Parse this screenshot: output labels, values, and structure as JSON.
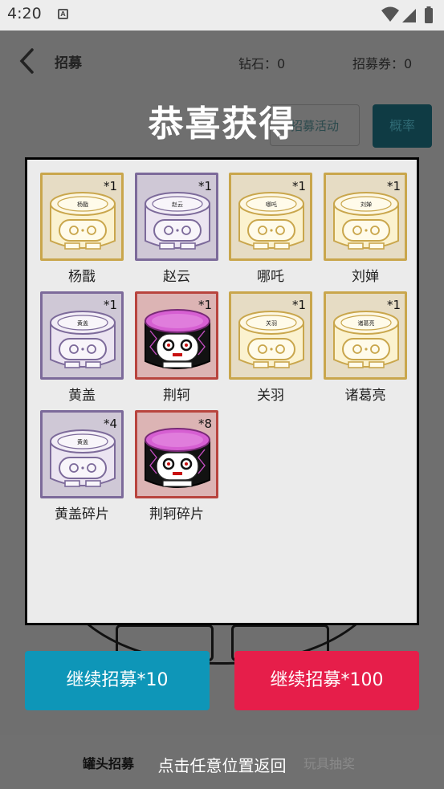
{
  "status_bar": {
    "time": "4:20",
    "notif_letter": "A"
  },
  "app_bar": {
    "title": "招募",
    "diamond": "钻石：0",
    "ticket": "招募券：0"
  },
  "background_buttons": {
    "activity": "招募活动",
    "probability": "概率"
  },
  "overlay": {
    "headline": "恭喜获得"
  },
  "items": [
    {
      "name": "杨戬",
      "count": "*1",
      "can_label": "杨戬",
      "style": "gold"
    },
    {
      "name": "赵云",
      "count": "*1",
      "can_label": "赵云",
      "style": "purple"
    },
    {
      "name": "哪吒",
      "count": "*1",
      "can_label": "哪吒",
      "style": "gold"
    },
    {
      "name": "刘婵",
      "count": "*1",
      "can_label": "刘婵",
      "style": "gold"
    },
    {
      "name": "黄盖",
      "count": "*1",
      "can_label": "黄盖",
      "style": "purple"
    },
    {
      "name": "荆轲",
      "count": "*1",
      "can_label": "",
      "style": "red"
    },
    {
      "name": "关羽",
      "count": "*1",
      "can_label": "关羽",
      "style": "gold"
    },
    {
      "name": "诸葛亮",
      "count": "*1",
      "can_label": "诸葛亮",
      "style": "gold"
    },
    {
      "name": "黄盖碎片",
      "count": "*4",
      "can_label": "黄盖",
      "style": "purple"
    },
    {
      "name": "荆轲碎片",
      "count": "*8",
      "can_label": "",
      "style": "red"
    }
  ],
  "actions": {
    "continue_10": "继续招募*10",
    "continue_100": "继续招募*100",
    "tap_return": "点击任意位置返回"
  },
  "bottom_nav": {
    "tab_can": "罐头招募",
    "tab_toy": "玩具抽奖"
  },
  "colors": {
    "gold_border": "#c9a64c",
    "purple_border": "#7c6a9a",
    "red_border": "#b8443e",
    "btn_blue": "#0e96b8",
    "btn_red": "#e61e4a"
  }
}
